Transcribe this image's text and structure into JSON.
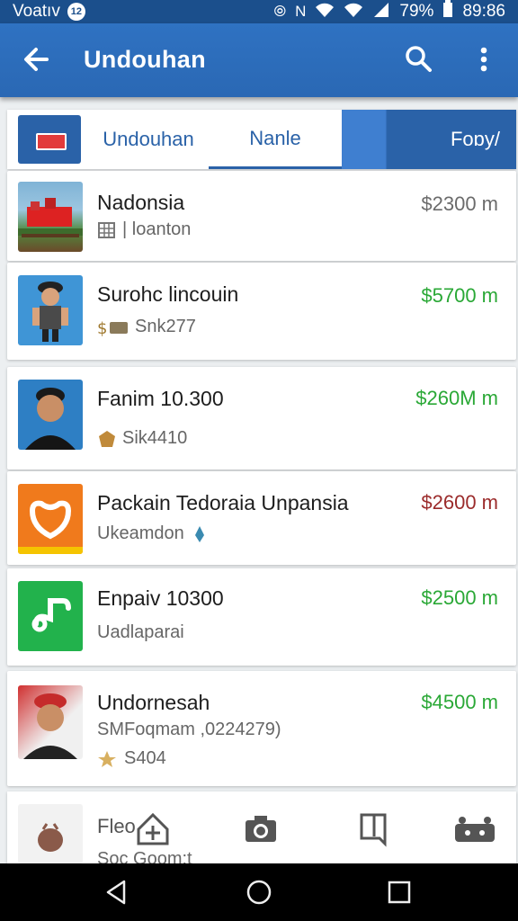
{
  "status_bar": {
    "carrier": "Voatıv",
    "notif_count": "12",
    "battery": "79%",
    "time": "89:86"
  },
  "app_bar": {
    "title": "Undouhan"
  },
  "tabs": [
    {
      "label": "Undouhan"
    },
    {
      "label": "Nanle"
    },
    {
      "label": "Foɒy/"
    }
  ],
  "items": [
    {
      "title": "Nadonsia",
      "subtitle": "| loanton",
      "price": "$2300 m",
      "price_color": "#6b6b6b"
    },
    {
      "title": "Surohc lincouin",
      "subtitle": "Snk277",
      "price": "$5700 m",
      "price_color": "#2aa836"
    },
    {
      "title": "Fanim 10.300",
      "subtitle": "Sik4410",
      "price": "$260M m",
      "price_color": "#2aa836"
    },
    {
      "title": "Packain Tedoraia Unpansia",
      "subtitle": "Ukeamdon",
      "price": "$2600 m",
      "price_color": "#9b2b2b"
    },
    {
      "title": "Enpaiv 10300",
      "subtitle": "Uadlaparai",
      "price": "$2500 m",
      "price_color": "#2aa836"
    },
    {
      "title": "Undornesah",
      "subtitle": "SMFoqmam ,0224279)",
      "subtitle2": "S404",
      "price": "$4500 m",
      "price_color": "#2aa836"
    }
  ],
  "partial_item": {
    "title": "Fleo",
    "subtitle": "Soc Goom:t"
  },
  "colors": {
    "primary": "#2a68b4",
    "status_bar": "#1b4f8c",
    "accent_green": "#2aa836"
  }
}
